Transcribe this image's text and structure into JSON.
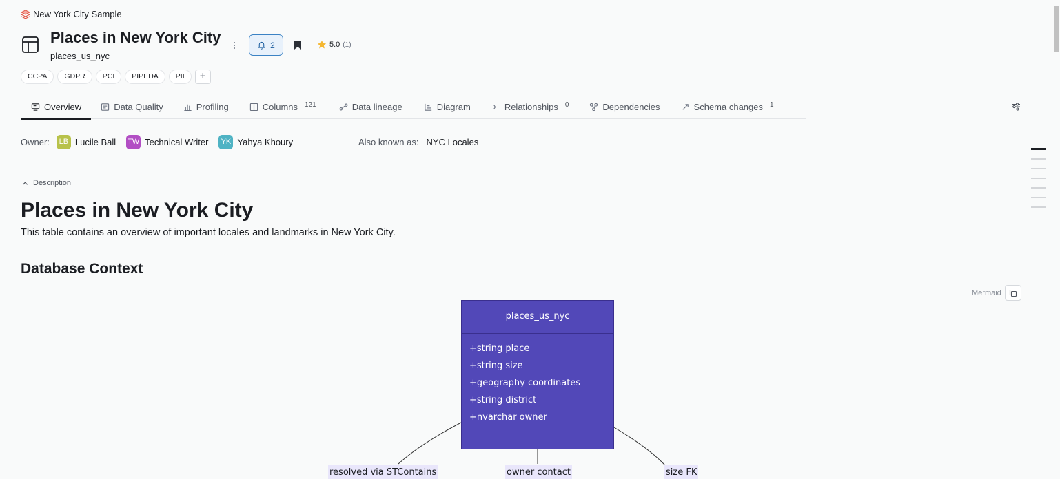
{
  "breadcrumb": {
    "label": "New York City Sample"
  },
  "header": {
    "title": "Places in New York City",
    "subtitle": "places_us_nyc",
    "notify_count": "2",
    "rating": "5.0",
    "rating_count": "(1)"
  },
  "tags": [
    "CCPA",
    "GDPR",
    "PCI",
    "PIPEDA",
    "PII"
  ],
  "tabs": [
    {
      "label": "Overview",
      "count": ""
    },
    {
      "label": "Data Quality",
      "count": ""
    },
    {
      "label": "Profiling",
      "count": ""
    },
    {
      "label": "Columns",
      "count": "121"
    },
    {
      "label": "Data lineage",
      "count": ""
    },
    {
      "label": "Diagram",
      "count": ""
    },
    {
      "label": "Relationships",
      "count": "0"
    },
    {
      "label": "Dependencies",
      "count": ""
    },
    {
      "label": "Schema changes",
      "count": "1"
    }
  ],
  "owners": {
    "label": "Owner:",
    "people": [
      {
        "initials": "LB",
        "name": "Lucile Ball",
        "color": "#b8c24a"
      },
      {
        "initials": "TW",
        "name": "Technical Writer",
        "color": "#b24ec4"
      },
      {
        "initials": "YK",
        "name": "Yahya Khoury",
        "color": "#4fb3c4"
      }
    ]
  },
  "aka": {
    "label": "Also known as:",
    "value": "NYC Locales"
  },
  "description": {
    "toggle_label": "Description",
    "heading": "Places in New York City",
    "text": "This table contains an overview of important locales and landmarks in New York City.",
    "section_heading": "Database Context"
  },
  "mermaid": {
    "label": "Mermaid"
  },
  "diagram": {
    "class_name": "places_us_nyc",
    "attributes": [
      "+string place",
      "+string size",
      "+geography coordinates",
      "+string district",
      "+nvarchar owner"
    ],
    "edge_labels": [
      "resolved via STContains",
      "owner contact",
      "size FK"
    ],
    "box_color": "#5248b8"
  }
}
